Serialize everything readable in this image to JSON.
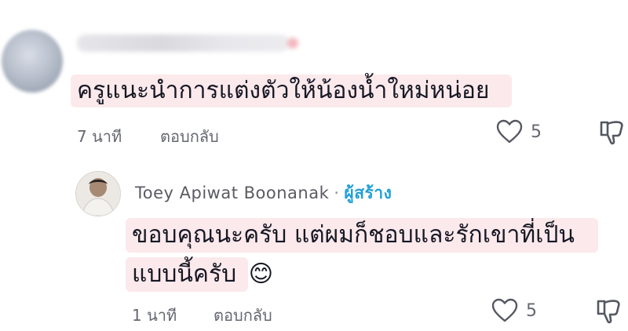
{
  "comments": [
    {
      "text": "ครูแนะนำการแต่งตัวให้น้องน้ำใหม่หน่อย",
      "time": "7 นาที",
      "reply_label": "ตอบกลับ",
      "likes": "5"
    }
  ],
  "reply": {
    "username": "Toey Apiwat Boonanak",
    "separator": "·",
    "badge": "ผู้สร้าง",
    "line1": "ขอบคุณนะครับ แต่ผมก็ชอบและรักเขาที่เป็น",
    "line2": "แบบนี้ครับ",
    "emoji": "😊",
    "time": "1 นาที",
    "reply_label": "ตอบกลับ",
    "likes": "5"
  },
  "icons": {
    "like": "heart-icon",
    "dislike": "thumbs-down-icon"
  },
  "colors": {
    "highlight": "#fbe9ec",
    "creator_badge": "#21a0d6"
  }
}
